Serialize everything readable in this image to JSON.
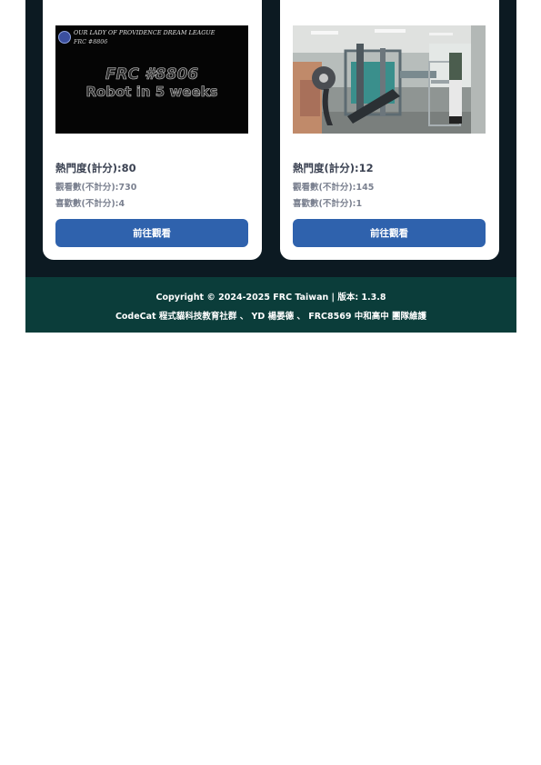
{
  "videos": [
    {
      "thumbnail": {
        "header_line1": "OUR LADY OF PROVIDENCE DREAM LEAGUE",
        "header_line2": "FRC #8806",
        "title_line1": "FRC #8806",
        "title_line2": "Robot in 5 weeks"
      },
      "score": "熱門度(計分):80",
      "views": "觀看數(不計分):730",
      "likes": "喜歡數(不計分):4",
      "button_label": "前往觀看"
    },
    {
      "thumbnail": {
        "description": "robot-workshop-photo"
      },
      "score": "熱門度(計分):12",
      "views": "觀看數(不計分):145",
      "likes": "喜歡數(不計分):1",
      "button_label": "前往觀看"
    }
  ],
  "footer": {
    "copyright": "Copyright © 2024-2025 FRC Taiwan | 版本: 1.3.8",
    "credits": "CodeCat 程式貓科技教育社群 、 YD 楊晏德 、 FRC8569 中和高中 團隊維護"
  },
  "colors": {
    "dark_background": "#0c1a22",
    "footer_background": "#0b3d3a",
    "button": "#2f62ad"
  }
}
